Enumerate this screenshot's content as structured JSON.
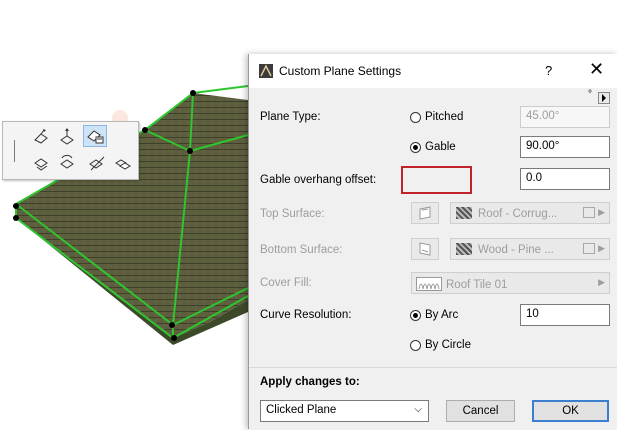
{
  "dialog": {
    "title": "Custom Plane Settings",
    "help_label": "?",
    "close_label": "✕",
    "expand_marker": "°",
    "plane_type": {
      "label": "Plane Type:",
      "options": [
        {
          "label": "Pitched",
          "selected": false,
          "value": "45.00°",
          "enabled": false
        },
        {
          "label": "Gable",
          "selected": true,
          "value": "90.00°",
          "enabled": true
        }
      ]
    },
    "gable_overhang": {
      "label": "Gable overhang offset:",
      "value": "0.0"
    },
    "top_surface": {
      "label": "Top Surface:",
      "material": "Roof - Corrug..."
    },
    "bottom_surface": {
      "label": "Bottom Surface:",
      "material": "Wood - Pine ..."
    },
    "cover_fill": {
      "label": "Cover Fill:",
      "value": "Roof Tile 01"
    },
    "curve_resolution": {
      "label": "Curve Resolution:",
      "options": [
        {
          "label": "By Arc",
          "selected": true,
          "value": "10"
        },
        {
          "label": "By Circle",
          "selected": false
        }
      ]
    },
    "apply_changes": {
      "label": "Apply changes to:",
      "selected": "Clicked Plane"
    },
    "cancel_label": "Cancel",
    "ok_label": "OK"
  },
  "toolbar": {
    "icons": [
      "roof-pivot-icon",
      "roof-elevate-icon",
      "custom-plane-settings-icon",
      "roof-offset-icon",
      "roof-rotate-icon",
      "roof-split-icon",
      "roof-copy-icon"
    ]
  },
  "colors": {
    "roof_texture": "#5d5e3e",
    "roof_edge": "#2ec52e",
    "accent_highlight": "#c0232a",
    "ok_border": "#3c7fd1"
  }
}
